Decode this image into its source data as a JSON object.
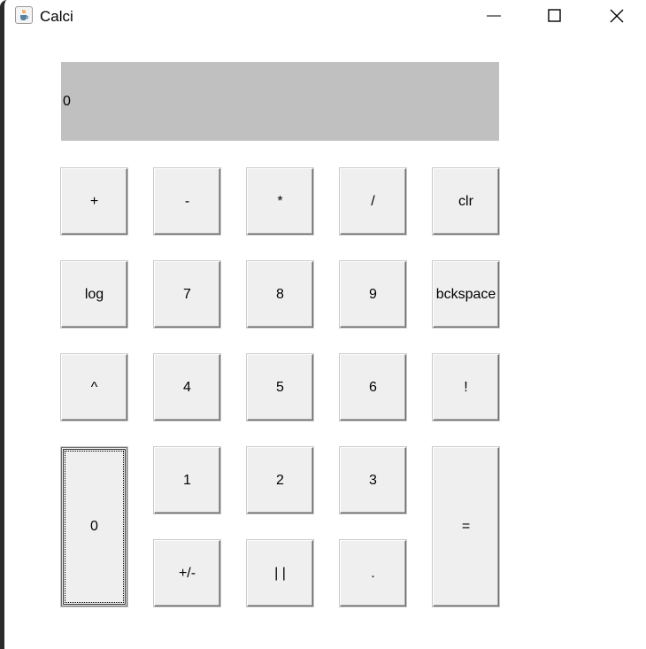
{
  "window": {
    "title": "Calci",
    "icon": "java-cup-icon",
    "controls": [
      "minimize-icon",
      "maximize-icon",
      "close-icon"
    ]
  },
  "display": {
    "value": "0"
  },
  "buttons": {
    "plus": "+",
    "minus": "-",
    "multiply": "*",
    "divide": "/",
    "clear": "clr",
    "log": "log",
    "seven": "7",
    "eight": "8",
    "nine": "9",
    "backspace": "bckspace",
    "power": "^",
    "four": "4",
    "five": "5",
    "six": "6",
    "factorial": "!",
    "zero": "0",
    "one": "1",
    "two": "2",
    "three": "3",
    "equals": "=",
    "negate": "+/-",
    "absolute": "| |",
    "decimal": "."
  }
}
